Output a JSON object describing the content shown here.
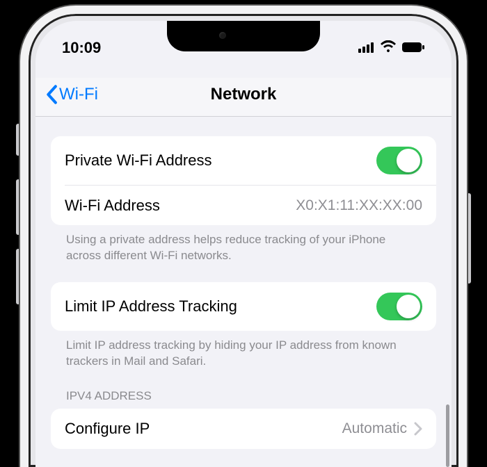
{
  "status": {
    "time": "10:09"
  },
  "nav": {
    "back": "Wi-Fi",
    "title": "Network"
  },
  "private_wifi": {
    "toggle_label": "Private Wi-Fi Address",
    "address_label": "Wi-Fi Address",
    "address_value": "X0:X1:11:XX:XX:00",
    "footer": "Using a private address helps reduce tracking of your iPhone across different Wi-Fi networks."
  },
  "limit_ip": {
    "label": "Limit IP Address Tracking",
    "footer": "Limit IP address tracking by hiding your IP address from known trackers in Mail and Safari."
  },
  "ipv4": {
    "header": "IPV4 ADDRESS",
    "configure_label": "Configure IP",
    "configure_value": "Automatic"
  }
}
